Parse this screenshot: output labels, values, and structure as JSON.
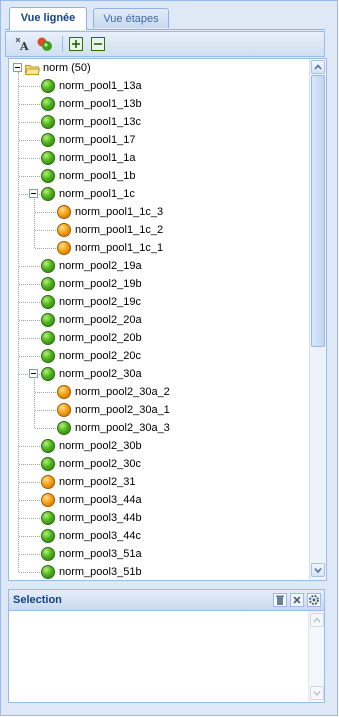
{
  "tabs": [
    {
      "label": "Vue lignée",
      "active": true
    },
    {
      "label": "Vue étapes",
      "active": false
    }
  ],
  "toolbar": {
    "icons": [
      "sort-text-icon",
      "refresh-color-icon",
      "expand-all-icon",
      "collapse-all-icon"
    ]
  },
  "tree": {
    "root": {
      "label": "norm (50)",
      "icon": "folder-open-icon",
      "expanded": true
    },
    "items": [
      {
        "label": "norm_pool1_13a",
        "status": "green",
        "level": 1
      },
      {
        "label": "norm_pool1_13b",
        "status": "green",
        "level": 1
      },
      {
        "label": "norm_pool1_13c",
        "status": "green",
        "level": 1
      },
      {
        "label": "norm_pool1_17",
        "status": "green",
        "level": 1
      },
      {
        "label": "norm_pool1_1a",
        "status": "green",
        "level": 1
      },
      {
        "label": "norm_pool1_1b",
        "status": "green",
        "level": 1
      },
      {
        "label": "norm_pool1_1c",
        "status": "green",
        "level": 1,
        "expanded": true
      },
      {
        "label": "norm_pool1_1c_3",
        "status": "orange",
        "level": 2
      },
      {
        "label": "norm_pool1_1c_2",
        "status": "orange",
        "level": 2
      },
      {
        "label": "norm_pool1_1c_1",
        "status": "orange",
        "level": 2
      },
      {
        "label": "norm_pool2_19a",
        "status": "green",
        "level": 1
      },
      {
        "label": "norm_pool2_19b",
        "status": "green",
        "level": 1
      },
      {
        "label": "norm_pool2_19c",
        "status": "green",
        "level": 1
      },
      {
        "label": "norm_pool2_20a",
        "status": "green",
        "level": 1
      },
      {
        "label": "norm_pool2_20b",
        "status": "green",
        "level": 1
      },
      {
        "label": "norm_pool2_20c",
        "status": "green",
        "level": 1
      },
      {
        "label": "norm_pool2_30a",
        "status": "green",
        "level": 1,
        "expanded": true
      },
      {
        "label": "norm_pool2_30a_2",
        "status": "orange",
        "level": 2
      },
      {
        "label": "norm_pool2_30a_1",
        "status": "orange",
        "level": 2
      },
      {
        "label": "norm_pool2_30a_3",
        "status": "green",
        "level": 2
      },
      {
        "label": "norm_pool2_30b",
        "status": "green",
        "level": 1
      },
      {
        "label": "norm_pool2_30c",
        "status": "green",
        "level": 1
      },
      {
        "label": "norm_pool2_31",
        "status": "orange",
        "level": 1
      },
      {
        "label": "norm_pool3_44a",
        "status": "orange",
        "level": 1
      },
      {
        "label": "norm_pool3_44b",
        "status": "green",
        "level": 1
      },
      {
        "label": "norm_pool3_44c",
        "status": "green",
        "level": 1
      },
      {
        "label": "norm_pool3_51a",
        "status": "green",
        "level": 1
      },
      {
        "label": "norm_pool3_51b",
        "status": "green",
        "level": 1
      }
    ]
  },
  "selection": {
    "title": "Selection",
    "buttons": [
      "trash-icon",
      "close-icon",
      "gear-icon"
    ]
  },
  "colors": {
    "accent": "#15428b",
    "border": "#99bbe8",
    "status_green": "#4fb51e",
    "status_orange": "#f6a21a"
  }
}
